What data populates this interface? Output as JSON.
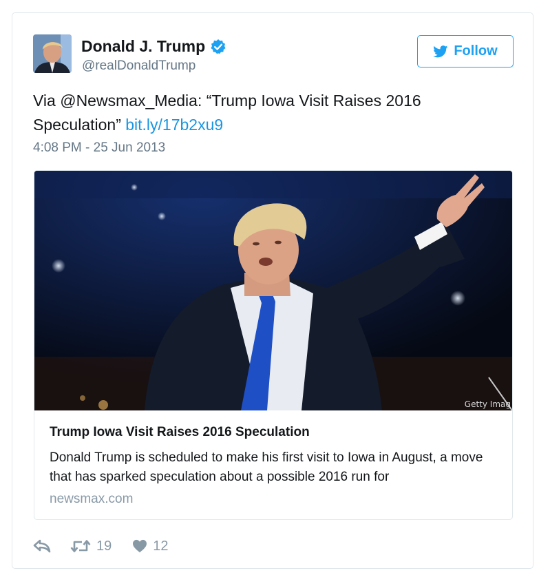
{
  "author": {
    "name": "Donald J. Trump",
    "handle": "@realDonaldTrump",
    "verified": true
  },
  "follow_label": "Follow",
  "tweet": {
    "text_prefix": "Via @Newsmax_Media: “Trump Iowa Visit Raises 2016 Speculation” ",
    "link_text": "bit.ly/17b2xu9",
    "timestamp": "4:08 PM - 25 Jun 2013"
  },
  "card": {
    "image_credit": "Getty Imag",
    "title": "Trump Iowa Visit Raises 2016 Speculation",
    "description": "Donald Trump is scheduled to make his first visit to Iowa in August, a move that has sparked speculation about a possible 2016 run for",
    "domain": "newsmax.com"
  },
  "stats": {
    "retweets": "19",
    "likes": "12"
  },
  "colors": {
    "brand": "#1da1f2",
    "link": "#1b95e0",
    "muted": "#657786",
    "border": "#e1e8ed"
  },
  "icons": {
    "reply": "reply-icon",
    "retweet": "retweet-icon",
    "like": "heart-icon",
    "verified": "verified-badge-icon",
    "follow": "twitter-bird-icon"
  }
}
